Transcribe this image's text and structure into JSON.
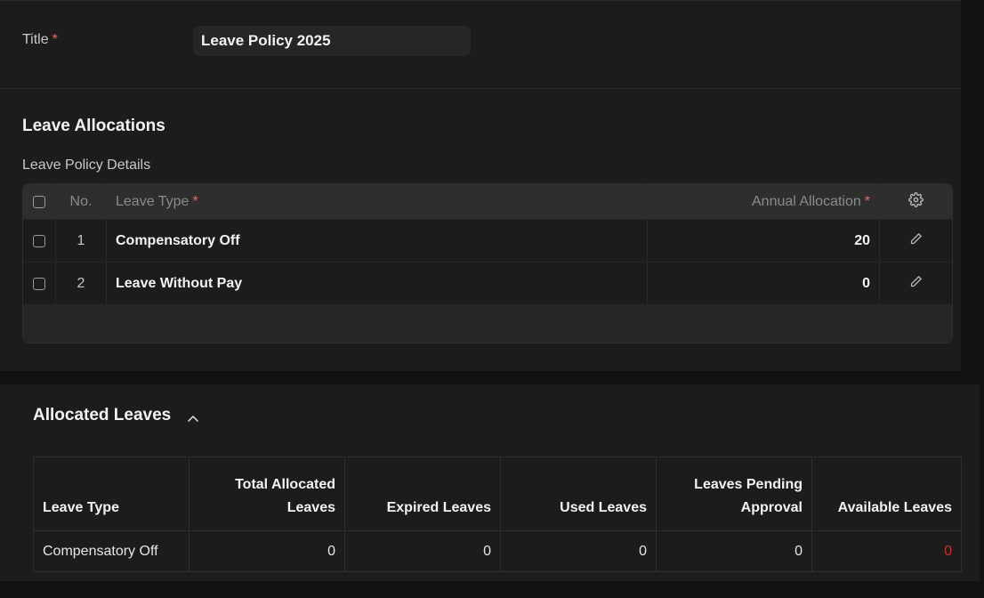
{
  "form": {
    "title_label": "Title",
    "required_mark": "*",
    "title_value": "Leave Policy 2025"
  },
  "allocations": {
    "section_title": "Leave Allocations",
    "table_label": "Leave Policy Details",
    "columns": {
      "no": "No.",
      "leave_type": "Leave Type",
      "annual_allocation": "Annual Allocation"
    },
    "rows": [
      {
        "no": "1",
        "leave_type": "Compensatory Off",
        "annual_allocation": "20"
      },
      {
        "no": "2",
        "leave_type": "Leave Without Pay",
        "annual_allocation": "0"
      }
    ],
    "icons": {
      "settings": "gear-icon",
      "edit": "pencil-icon"
    }
  },
  "allocated_leaves": {
    "section_title": "Allocated Leaves",
    "toggle_icon": "chevron-up-icon",
    "columns": [
      "Leave Type",
      "Total Allocated Leaves",
      "Expired Leaves",
      "Used Leaves",
      "Leaves Pending Approval",
      "Available Leaves"
    ],
    "rows": [
      {
        "leave_type": "Compensatory Off",
        "total": "0",
        "expired": "0",
        "used": "0",
        "pending": "0",
        "available": "0"
      }
    ]
  },
  "colors": {
    "required": "#e56b6b",
    "negative": "#e02424",
    "panel": "#1c1c1c",
    "header": "#2e2e2e"
  }
}
